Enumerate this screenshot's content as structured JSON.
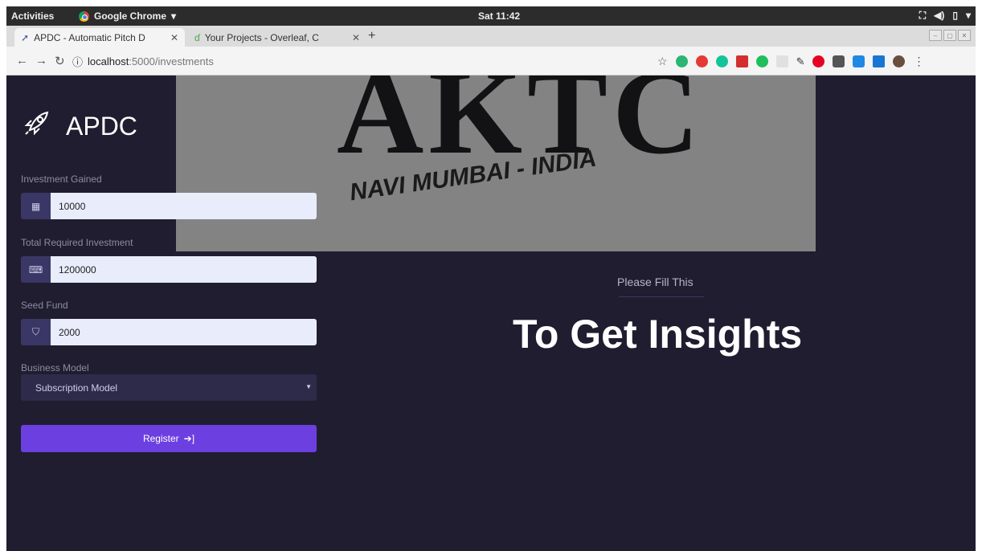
{
  "os_bar": {
    "activities": "Activities",
    "app_name": "Google Chrome",
    "clock": "Sat 11:42"
  },
  "browser": {
    "tabs": [
      {
        "title": "APDC - Automatic Pitch D",
        "active": true
      },
      {
        "title": "Your Projects - Overleaf, C",
        "active": false
      }
    ],
    "url_host": "localhost",
    "url_rest": ":5000/investments"
  },
  "watermark": {
    "logo_text": "AKTC",
    "subtitle": "NAVI MUMBAI - INDIA"
  },
  "sidebar": {
    "brand": "APDC",
    "fields": [
      {
        "label": "Investment Gained",
        "value": "10000",
        "icon": "building-icon"
      },
      {
        "label": "Total Required Investment",
        "value": "1200000",
        "icon": "laptop-icon"
      },
      {
        "label": "Seed Fund",
        "value": "2000",
        "icon": "shield-icon"
      }
    ],
    "business_model": {
      "label": "Business Model",
      "selected": "Subscription Model"
    },
    "register_label": "Register"
  },
  "main": {
    "subtitle": "Please Fill This",
    "heading": "To Get Insights"
  },
  "colors": {
    "background": "#1f1d2f",
    "accent": "#6c3fe0",
    "input_icon_bg": "#3a3766",
    "input_bg": "#e8ecfb"
  }
}
